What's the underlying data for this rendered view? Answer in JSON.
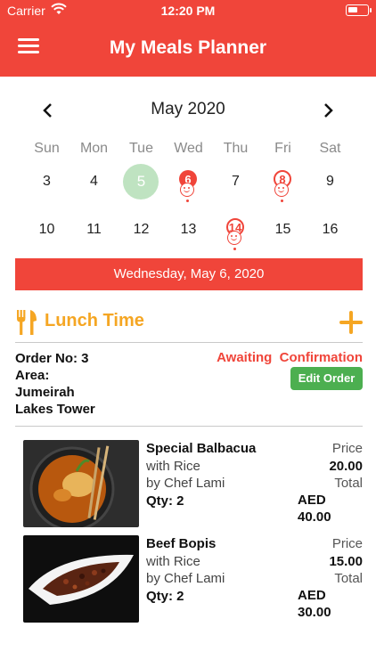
{
  "status_bar": {
    "carrier": "Carrier",
    "time": "12:20 PM"
  },
  "header": {
    "title": "My Meals Planner",
    "menu_icon": "hamburger-menu-icon"
  },
  "calendar": {
    "month_label": "May 2020",
    "weekdays": [
      "Sun",
      "Mon",
      "Tue",
      "Wed",
      "Thu",
      "Fri",
      "Sat"
    ],
    "week1": [
      "3",
      "4",
      "5",
      "6",
      "7",
      "8",
      "9"
    ],
    "week2": [
      "10",
      "11",
      "12",
      "13",
      "14",
      "15",
      "16"
    ],
    "today": "5",
    "meal_days_filled": [
      "6"
    ],
    "meal_days_outline": [
      "8",
      "14"
    ]
  },
  "selected_date": "Wednesday, May 6, 2020",
  "meal": {
    "title": "Lunch Time",
    "order_no": "Order No: 3",
    "area_label": "Area:",
    "area_line1": "Jumeirah",
    "area_line2": "Lakes Tower",
    "status": "Awaiting  Confirmation",
    "edit_label": "Edit Order",
    "items": [
      {
        "name": "Special Balbacua",
        "with": "with Rice",
        "chef": "by Chef Lami",
        "qty": "Qty: 2",
        "price_label": "Price",
        "price": "20.00",
        "total_label": "Total",
        "currency": "AED",
        "total": "40.00"
      },
      {
        "name": "Beef Bopis",
        "with": "with Rice",
        "chef": "by Chef Lami",
        "qty": "Qty: 2",
        "price_label": "Price",
        "price": "15.00",
        "total_label": "Total",
        "currency": "AED",
        "total": "30.00"
      }
    ]
  },
  "colors": {
    "primary": "#f0453a",
    "accent": "#f5a623",
    "success": "#4caf50",
    "today": "#bfe3c1"
  }
}
